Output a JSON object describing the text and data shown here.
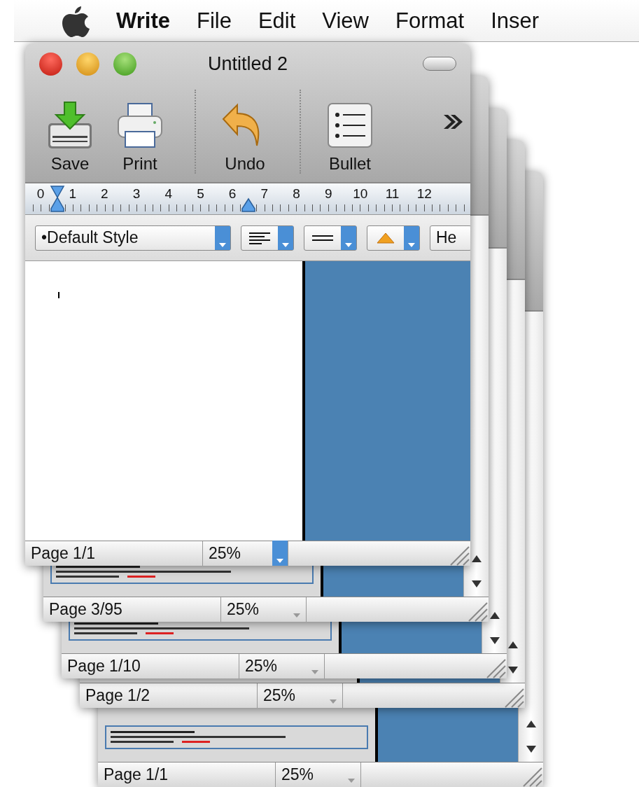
{
  "menubar": {
    "app": "Write",
    "items": [
      "File",
      "Edit",
      "View",
      "Format",
      "Inser"
    ]
  },
  "windows": [
    {
      "title": "Untitled 2",
      "active": true,
      "toolbar": [
        {
          "label": "Save",
          "kind": "save",
          "separator_before": false
        },
        {
          "label": "Print",
          "kind": "print",
          "separator_before": false
        },
        {
          "label": "Undo",
          "kind": "undo",
          "separator_before": true
        },
        {
          "label": "Bullet",
          "kind": "bullet",
          "separator_before": true
        }
      ],
      "ruler": [
        "0",
        "1",
        "2",
        "3",
        "4",
        "5",
        "6",
        "7",
        "8",
        "9",
        "10",
        "11",
        "12"
      ],
      "format_bar": {
        "style": "•Default Style",
        "font": "He"
      },
      "status": {
        "page": "Page 1/1",
        "zoom": "25%"
      }
    },
    {
      "active": false,
      "status": {
        "page": "Page 3/95",
        "zoom": "25%"
      }
    },
    {
      "active": false,
      "status": {
        "page": "Page 1/10",
        "zoom": "25%"
      }
    },
    {
      "active": false,
      "status": {
        "page": "Page 1/2",
        "zoom": "25%"
      }
    },
    {
      "active": false,
      "status": {
        "page": "Page 1/1",
        "zoom": "25%"
      }
    }
  ]
}
